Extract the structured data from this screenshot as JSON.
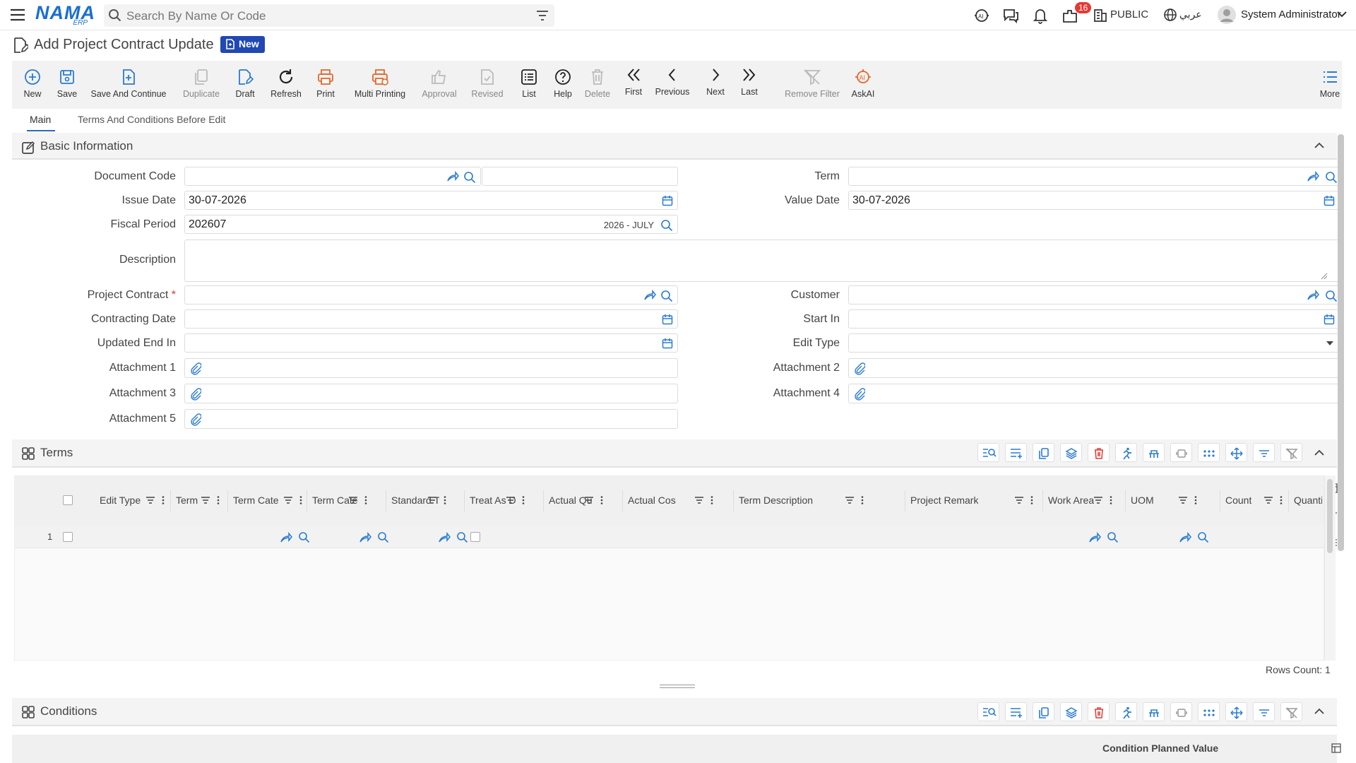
{
  "topbar": {
    "logo_text": "NAMA",
    "logo_sub": "ERP",
    "search_placeholder": "Search By Name Or Code",
    "notification_count": "16",
    "public_label": "PUBLIC",
    "language_label": "عربي",
    "user_name": "System Administrator"
  },
  "page": {
    "title": "Add Project Contract Update",
    "badge": "New"
  },
  "toolbar": {
    "items": [
      {
        "label": "New",
        "icon": "plus-circle-icon"
      },
      {
        "label": "Save",
        "icon": "save-icon"
      },
      {
        "label": "Save And Continue",
        "icon": "save-continue-icon"
      },
      {
        "label": "Duplicate",
        "icon": "duplicate-icon"
      },
      {
        "label": "Draft",
        "icon": "draft-icon"
      },
      {
        "label": "Refresh",
        "icon": "refresh-icon"
      },
      {
        "label": "Print",
        "icon": "print-icon"
      },
      {
        "label": "Multi Printing",
        "icon": "multi-print-icon"
      },
      {
        "label": "Approval",
        "icon": "thumb-up-icon"
      },
      {
        "label": "Revised",
        "icon": "revised-icon"
      },
      {
        "label": "List",
        "icon": "list-icon"
      },
      {
        "label": "Help",
        "icon": "help-icon"
      },
      {
        "label": "Delete",
        "icon": "trash-icon"
      },
      {
        "label": "First",
        "icon": "double-chevron-left-icon"
      },
      {
        "label": "Previous",
        "icon": "chevron-left-icon"
      },
      {
        "label": "Next",
        "icon": "chevron-right-icon"
      },
      {
        "label": "Last",
        "icon": "double-chevron-right-icon"
      },
      {
        "label": "Remove Filter",
        "icon": "remove-filter-icon"
      },
      {
        "label": "AskAI",
        "icon": "ai-icon"
      },
      {
        "label": "More",
        "icon": "more-list-icon"
      }
    ]
  },
  "tabs": [
    {
      "label": "Main",
      "active": true
    },
    {
      "label": "Terms And Conditions Before Edit",
      "active": false
    }
  ],
  "basic_info": {
    "title": "Basic Information",
    "document_code_label": "Document Code",
    "term_label": "Term",
    "issue_date_label": "Issue Date",
    "issue_date": "30-07-2026",
    "value_date_label": "Value Date",
    "value_date": "30-07-2026",
    "fiscal_period_label": "Fiscal Period",
    "fiscal_period": "202607",
    "fiscal_period_desc": "2026 - JULY",
    "description_label": "Description",
    "project_contract_label": "Project Contract",
    "required_mark": "*",
    "customer_label": "Customer",
    "contracting_date_label": "Contracting Date",
    "start_in_label": "Start In",
    "updated_end_in_label": "Updated End In",
    "edit_type_label": "Edit Type",
    "attachment1_label": "Attachment 1",
    "attachment2_label": "Attachment 2",
    "attachment3_label": "Attachment 3",
    "attachment4_label": "Attachment 4",
    "attachment5_label": "Attachment 5"
  },
  "terms": {
    "title": "Terms",
    "columns": [
      "Edit Type",
      "Term",
      "Term Cate",
      "Term Cate",
      "Standard T",
      "Treat As D",
      "Actual Qu",
      "Actual Cos",
      "Term Description",
      "Project Remark",
      "Work Area",
      "UOM",
      "Count",
      "Quanti"
    ],
    "row_number": "1",
    "rows_count": "Rows Count: 1"
  },
  "conditions": {
    "title": "Conditions",
    "header_right": "Condition Planned Value"
  }
}
